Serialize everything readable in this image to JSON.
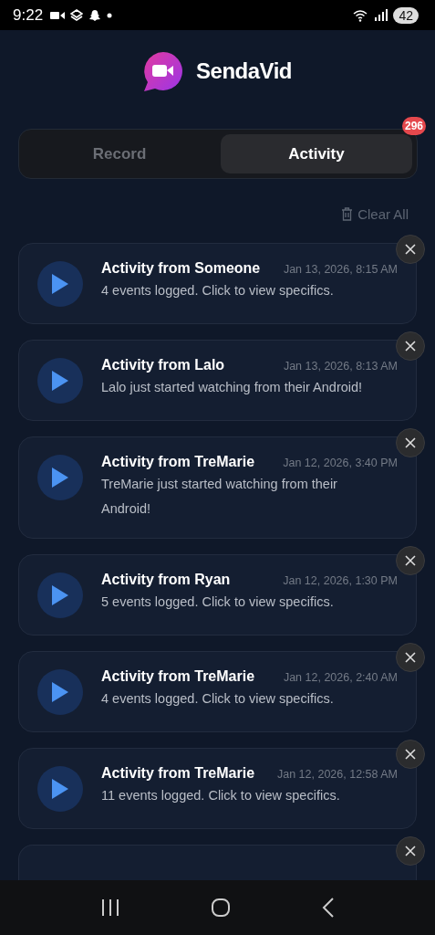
{
  "status_bar": {
    "time": "9:22",
    "battery": "42"
  },
  "header": {
    "app_name": "SendaVid"
  },
  "tabs": [
    {
      "label": "Record",
      "selected": false
    },
    {
      "label": "Activity",
      "selected": true,
      "badge": "296"
    }
  ],
  "clear_all": "Clear All",
  "activities": [
    {
      "kind": "full",
      "title": "Activity from Someone",
      "time": "Jan 13, 2026, 8:15 AM",
      "message": "4 events logged. Click to view specifics."
    },
    {
      "kind": "full",
      "title": "Activity from Lalo",
      "time": "Jan 13, 2026, 8:13 AM",
      "message": "Lalo just started watching from their Android!"
    },
    {
      "kind": "full",
      "title": "Activity from TreMarie",
      "time": "Jan 12, 2026, 3:40 PM",
      "message": "TreMarie just started watching from their Android!"
    },
    {
      "kind": "full",
      "title": "Activity from Ryan",
      "time": "Jan 12, 2026, 1:30 PM",
      "message": "5 events logged. Click to view specifics."
    },
    {
      "kind": "full",
      "title": "Activity from TreMarie",
      "time": "Jan 12, 2026, 2:40 AM",
      "message": "4 events logged. Click to view specifics."
    },
    {
      "kind": "full",
      "title": "Activity from TreMarie",
      "time": "Jan 12, 2026, 12:58 AM",
      "message": "11 events logged. Click to view specifics."
    },
    {
      "kind": "partial"
    }
  ]
}
